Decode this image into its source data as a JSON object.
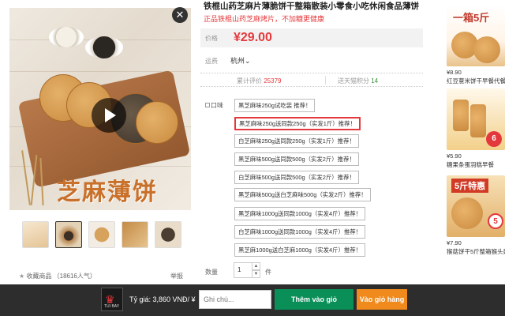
{
  "product": {
    "title": "铁棍山药芝麻片薄脆饼干整箱散装小零食小吃休闲食品薄饼",
    "subtitle": "正品铁棍山药芝麻烤片，不加糖更健康",
    "image_text": "芝麻薄饼",
    "price_label": "价格",
    "price": "¥29.00",
    "ship_label": "运费",
    "ship_from": "杭州",
    "reviews_label": "累计评价",
    "reviews": "25379",
    "points_label": "送天猫积分",
    "points": "14",
    "flavor_label": "口味",
    "flavors": [
      "黑芝麻味250g试吃装 推荐！",
      "黑芝麻味250g送同款250g（实发1斤）推荐！",
      "白芝麻味250g送同款250g（实发1斤）推荐！",
      "黑芝麻味500g送同款500g（实发2斤）推荐！",
      "白芝麻味500g送同款500g（实发2斤）推荐！",
      "黑芝麻味500g送白芝麻味500g（实发2斤）推荐！",
      "黑芝麻味1000g送同款1000g（实发4斤）推荐！",
      "白芝麻味1000g送同款1000g（实发4斤）推荐！",
      "黑芝麻1000g送白芝麻1000g（实发4斤）推荐！"
    ],
    "selected_flavor_index": 1,
    "qty_label": "数量",
    "qty": "1",
    "qty_unit": "件",
    "favorite": "收藏商品 （18616人气）",
    "report": "举报"
  },
  "recommendations": [
    {
      "badge": "一箱5斤",
      "price": "¥8.90",
      "title": "红豆薏米饼干早餐代餐",
      "badge_color": "#c0392b"
    },
    {
      "badge": "6",
      "price": "¥5.90",
      "title": "糖果条蛋羽糕早餐",
      "badge_color": "#e4393c"
    },
    {
      "badge": "5斤特惠",
      "badge2": "5",
      "price": "¥7.90",
      "title": "猴菇饼干5斤整箱猴头菇无加糖",
      "badge_color": "#d13b26"
    }
  ],
  "extension_bar": {
    "logo_text": "TUI BAY",
    "rate": "Tỷ giá: 3,860 VNĐ/ ¥",
    "note_placeholder": "Ghi chú...",
    "add_button": "Thêm vào giỏ",
    "cart_button": "Vào giỏ hàng"
  },
  "colors": {
    "accent": "#e4393c",
    "add_green": "#0a8f59",
    "cart_orange": "#f08a1c",
    "bar_bg": "#2d2d2d"
  },
  "icons": [
    "close-icon",
    "play-icon",
    "chevron-down-icon",
    "star-icon",
    "checkbox-icon"
  ]
}
